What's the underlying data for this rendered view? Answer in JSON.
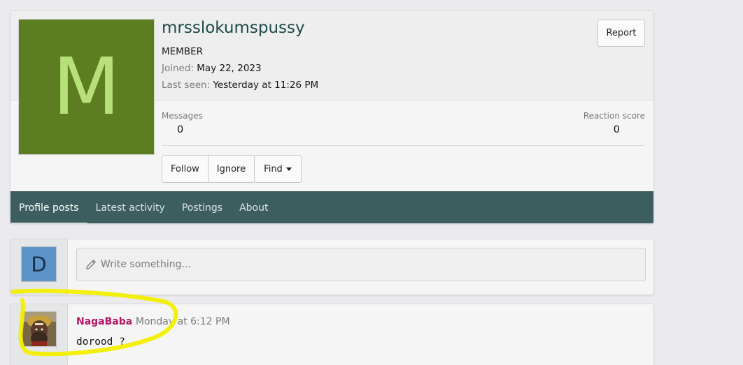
{
  "member": {
    "avatar_letter": "M",
    "username": "mrsslokumspussy",
    "title": "MEMBER",
    "joined_label": "Joined:",
    "joined_value": "May 22, 2023",
    "last_seen_label": "Last seen:",
    "last_seen_value": "Yesterday at 11:26 PM",
    "report_label": "Report",
    "stats": {
      "messages_label": "Messages",
      "messages_value": "0",
      "reaction_label": "Reaction score",
      "reaction_value": "0"
    },
    "actions": {
      "follow": "Follow",
      "ignore": "Ignore",
      "find": "Find"
    },
    "colors": {
      "avatar_bg": "#5c7e20",
      "avatar_letter": "#b8e07a",
      "tab_bar": "#3d5e5e",
      "username": "#1e4a4a"
    }
  },
  "tabs": [
    {
      "label": "Profile posts",
      "active": true
    },
    {
      "label": "Latest activity",
      "active": false
    },
    {
      "label": "Postings",
      "active": false
    },
    {
      "label": "About",
      "active": false
    }
  ],
  "composer": {
    "avatar_letter": "D",
    "placeholder": "Write something...",
    "icon": "pencil-icon"
  },
  "post": {
    "author": "NagaBaba",
    "time": "· Monday at 6:12 PM",
    "body": "dorood ?",
    "author_color": "#b31667"
  },
  "annotation": {
    "color": "#f2ef00"
  }
}
